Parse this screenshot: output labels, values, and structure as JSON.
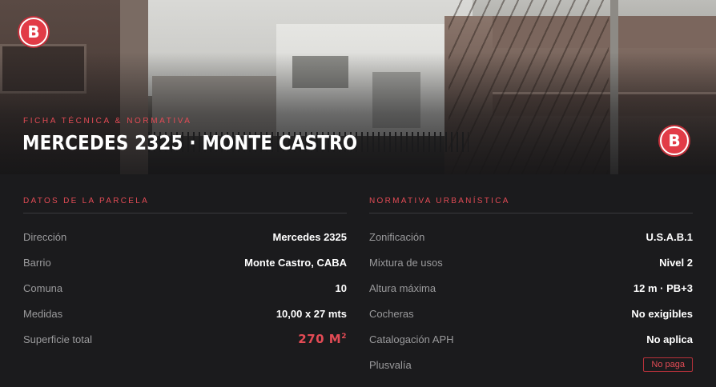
{
  "hero": {
    "eyebrow": "FICHA TÉCNICA & NORMATIVA",
    "title": "MERCEDES 2325 · MONTE CASTRO",
    "badge_letter": "B"
  },
  "parcela": {
    "heading": "DATOS DE LA PARCELA",
    "rows": [
      {
        "label": "Dirección",
        "value": "Mercedes 2325"
      },
      {
        "label": "Barrio",
        "value": "Monte Castro, CABA"
      },
      {
        "label": "Comuna",
        "value": "10"
      },
      {
        "label": "Medidas",
        "value": "10,00 x 27 mts"
      },
      {
        "label": "Superficie total",
        "value": "270 M",
        "unit_sup": "2"
      }
    ]
  },
  "normativa": {
    "heading": "NORMATIVA URBANÍSTICA",
    "rows": [
      {
        "label": "Zonificación",
        "value": "U.S.A.B.1"
      },
      {
        "label": "Mixtura de usos",
        "value": "Nivel 2"
      },
      {
        "label": "Altura máxima",
        "value": "12 m · PB+3"
      },
      {
        "label": "Cocheras",
        "value": "No exigibles"
      },
      {
        "label": "Catalogación APH",
        "value": "No aplica"
      },
      {
        "label": "Plusvalía",
        "value": "No paga"
      }
    ]
  },
  "colors": {
    "accent": "#e34b55",
    "background": "#1b1b1d",
    "badge": "#e23b47"
  }
}
